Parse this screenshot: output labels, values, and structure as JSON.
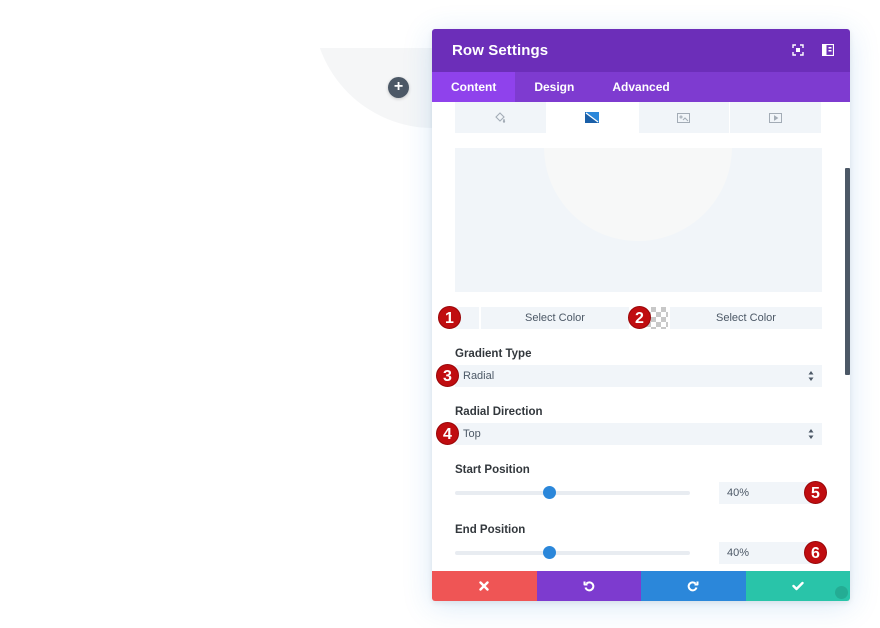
{
  "background_page": {
    "add_row_button_icon": "plus-icon",
    "add_row_label": "+"
  },
  "modal": {
    "title": "Row Settings",
    "header_icons": [
      "fullscreen-icon",
      "sidebar-toggle-icon"
    ],
    "tabs": [
      {
        "label": "Content",
        "active": true
      },
      {
        "label": "Design",
        "active": false
      },
      {
        "label": "Advanced",
        "active": false
      }
    ],
    "background_type_tabs": [
      {
        "icon": "paint-bucket-icon",
        "active": false
      },
      {
        "icon": "gradient-icon",
        "active": true
      },
      {
        "icon": "image-icon",
        "active": false
      },
      {
        "icon": "video-icon",
        "active": false
      }
    ],
    "gradient_colors": [
      {
        "label": "Select Color",
        "badge": "1"
      },
      {
        "label": "Select Color",
        "badge": "2"
      }
    ],
    "gradient_type": {
      "label": "Gradient Type",
      "value": "Radial",
      "badge": "3"
    },
    "radial_direction": {
      "label": "Radial Direction",
      "value": "Top",
      "badge": "4"
    },
    "start_position": {
      "label": "Start Position",
      "value": "40%",
      "percent": 40,
      "badge": "5"
    },
    "end_position": {
      "label": "End Position",
      "value": "40%",
      "percent": 40,
      "badge": "6"
    },
    "footer": {
      "cancel_icon": "close-icon",
      "undo_icon": "undo-icon",
      "redo_icon": "redo-icon",
      "save_icon": "check-icon"
    }
  },
  "colors": {
    "header": "#6c2eb9",
    "tabs": "#7e3bd0",
    "tab_active": "#8f42ec",
    "cancel": "#ef5555",
    "undo": "#7d3bcf",
    "redo": "#2b87da",
    "save": "#29c4a9",
    "badge": "#c00d10",
    "slider_thumb": "#2b87da"
  }
}
